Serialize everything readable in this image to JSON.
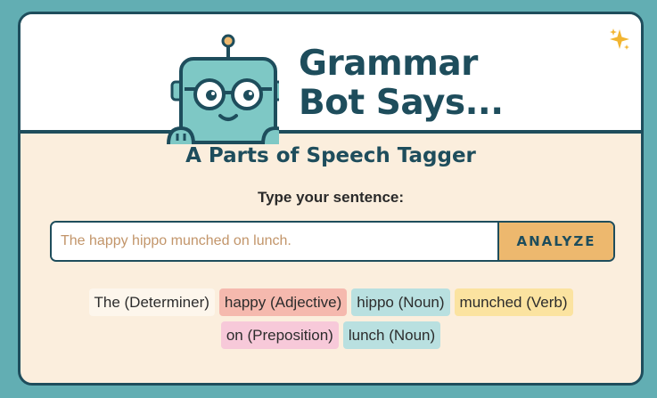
{
  "header": {
    "title_line1": "Grammar",
    "title_line2": "Bot Says...",
    "sparkle_icon": "sparkles-icon",
    "mascot_icon": "robot-icon"
  },
  "subtitle": "A Parts of Speech Tagger",
  "form": {
    "prompt": "Type your sentence:",
    "placeholder": "The happy hippo munched on lunch.",
    "value": "",
    "button_label": "ANALYZE"
  },
  "tags": [
    {
      "text": "The (Determiner)",
      "color": "#fdf6ec"
    },
    {
      "text": "happy (Adjective)",
      "color": "#f5b9ae"
    },
    {
      "text": "hippo (Noun)",
      "color": "#b9e0e0"
    },
    {
      "text": "munched (Verb)",
      "color": "#fbe3a0"
    },
    {
      "text": "on (Preposition)",
      "color": "#f7c9d9"
    },
    {
      "text": "lunch (Noun)",
      "color": "#b9e0e0"
    }
  ],
  "colors": {
    "background": "#62aeb3",
    "primary": "#1e4d5c",
    "panel": "#fbeedd",
    "accent": "#edb86e"
  }
}
